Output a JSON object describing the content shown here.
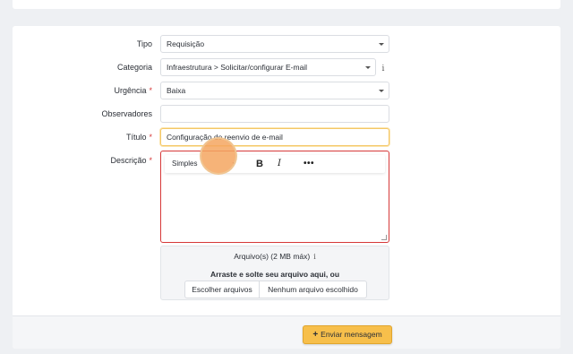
{
  "form": {
    "tipo": {
      "label": "Tipo",
      "value": "Requisição"
    },
    "categoria": {
      "label": "Categoria",
      "value": "Infraestrutura > Solicitar/configurar E-mail"
    },
    "urgencia": {
      "label": "Urgência",
      "required_mark": "*",
      "value": "Baixa"
    },
    "observadores": {
      "label": "Observadores",
      "value": ""
    },
    "titulo": {
      "label": "Título",
      "required_mark": "*",
      "value": "Configuração de reenvio de e-mail"
    },
    "descricao": {
      "label": "Descrição",
      "required_mark": "*",
      "toolbar": {
        "format": "Simples",
        "bold": "B",
        "italic": "I",
        "more": "•••"
      }
    },
    "upload": {
      "title": "Arquivo(s) (2 MB máx)",
      "info_icon": "i",
      "hint": "Arraste e solte seu arquivo aqui, ou",
      "choose_button": "Escolher arquivos",
      "no_file": "Nenhum arquivo escolhido"
    }
  },
  "actions": {
    "submit_label": "Enviar mensagem",
    "submit_icon": "+"
  },
  "icons": {
    "categoria_info": "i"
  },
  "colors": {
    "accent": "#f7bf4b",
    "error_border": "#d63939",
    "focus_border": "#f4c766"
  }
}
